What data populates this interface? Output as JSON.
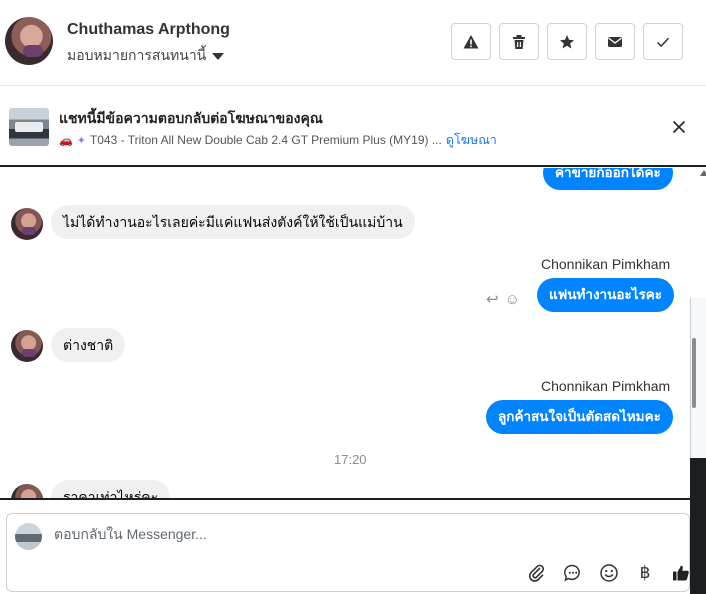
{
  "header": {
    "name": "Chuthamas Arpthong",
    "assign_label": "มอบหมายการสนทนานี้",
    "buttons": [
      "warning-icon",
      "trash-icon",
      "star-icon",
      "envelope-icon",
      "check-icon"
    ]
  },
  "ad": {
    "title": "แชทนี้มีข้อความตอบกลับต่อโฆษณาของคุณ",
    "car_emoji": "🚗",
    "sparkle": "✦",
    "subtitle": "T043 - Triton All New Double Cab 2.4 GT Premium Plus (MY19) ...",
    "link": "ดูโฆษณา"
  },
  "thread": {
    "partial_out": "ค่าขายก็ออกได้คะ",
    "messages": [
      {
        "side": "in",
        "text": "ไม่ได้ทำงานอะไรเลยค่ะมีแค่แฟนส่งตังค์ให้ใช้เป็นแม่บ้าน"
      },
      {
        "side": "out",
        "sender": "Chonnikan Pimkham",
        "text": "แฟนทำงานอะไรคะ"
      },
      {
        "side": "in",
        "text": "ต่างชาติ"
      },
      {
        "side": "out",
        "sender": "Chonnikan Pimkham",
        "text": "ลูกค้าสนใจเป็นตัดสดไหมคะ"
      },
      {
        "side": "in",
        "text": "ราคาเท่าไหร่คะ"
      }
    ],
    "timestamp": "17:20"
  },
  "composer": {
    "placeholder": "ตอบกลับใน Messenger...",
    "tools": [
      "paperclip-icon",
      "chat-bubble-icon",
      "smiley-icon",
      "baht-icon",
      "thumbs-up-icon"
    ],
    "baht_symbol": "฿"
  }
}
